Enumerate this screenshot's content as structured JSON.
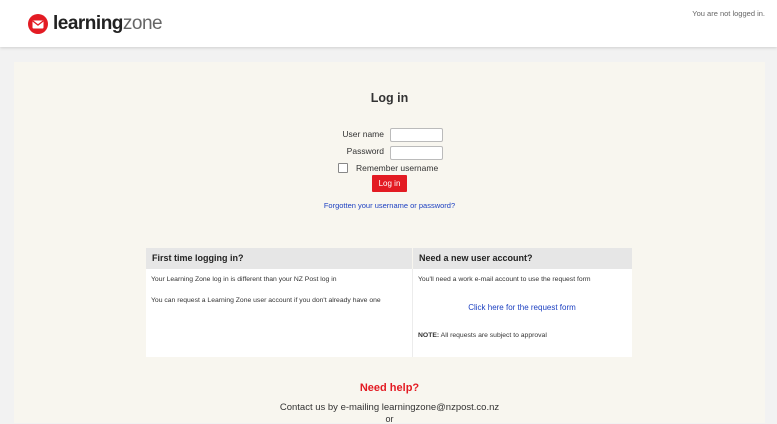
{
  "header": {
    "brand_bold": "learning",
    "brand_light": "zone",
    "login_status": "You are not logged in."
  },
  "login": {
    "title": "Log in",
    "username_label": "User name",
    "password_label": "Password",
    "username_value": "",
    "password_value": "",
    "remember_label": "Remember username",
    "remember_checked": false,
    "login_button": "Log in",
    "forgot_link": "Forgotten your username or password?"
  },
  "info": {
    "first_time": {
      "heading": "First time logging in?",
      "line1": "Your Learning Zone log in is different than your NZ Post log in",
      "line2": "You can request a Learning Zone user account if you don't already have one"
    },
    "new_account": {
      "heading": "Need a new user account?",
      "line1": "You'll need a work e-mail account to use the request form",
      "link": "Click here for the request form",
      "note_label": "NOTE:",
      "note_text": " All requests are subject to approval"
    }
  },
  "help": {
    "title": "Need help?",
    "text": "Contact us by e-mailing learningzone@nzpost.co.nz",
    "or": "or"
  },
  "colors": {
    "brand_red": "#e31b23",
    "link_blue": "#1b3fc1",
    "panel_bg": "#f8f6ef",
    "page_bg": "#f2f2f2"
  },
  "icons": {
    "logo": "envelope-circle-icon"
  }
}
